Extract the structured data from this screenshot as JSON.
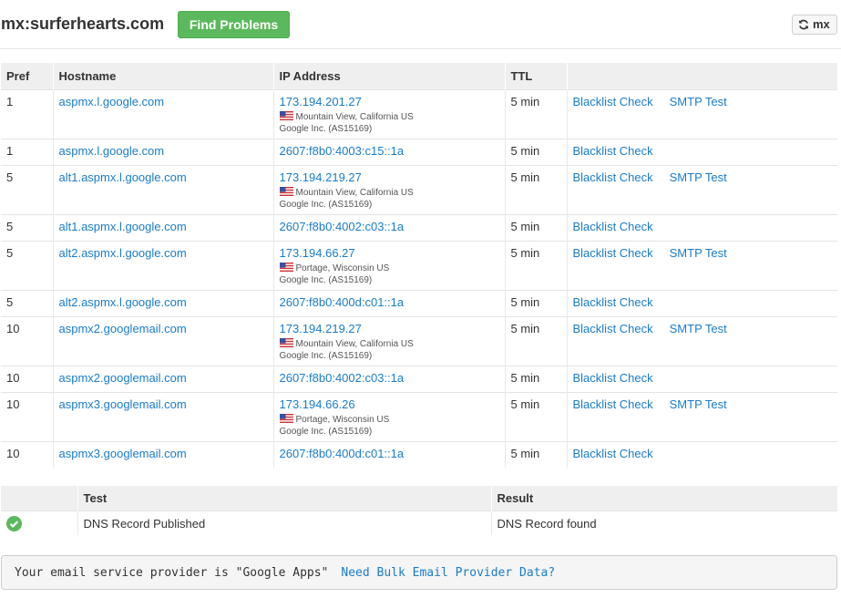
{
  "header": {
    "title": "mx:surferhearts.com",
    "find_button": "Find Problems",
    "mx_button": "mx"
  },
  "mx_table": {
    "columns": [
      "Pref",
      "Hostname",
      "IP Address",
      "TTL",
      ""
    ],
    "rows": [
      {
        "pref": "1",
        "hostname": "aspmx.l.google.com",
        "ip": "173.194.201.27",
        "location": "Mountain View, California US",
        "asn": "Google Inc. (AS15169)",
        "ttl": "5 min",
        "action1": "Blacklist Check",
        "action2": "SMTP Test"
      },
      {
        "pref": "1",
        "hostname": "aspmx.l.google.com",
        "ip": "2607:f8b0:4003:c15::1a",
        "location": "",
        "asn": "",
        "ttl": "5 min",
        "action1": "Blacklist Check",
        "action2": ""
      },
      {
        "pref": "5",
        "hostname": "alt1.aspmx.l.google.com",
        "ip": "173.194.219.27",
        "location": "Mountain View, California US",
        "asn": "Google Inc. (AS15169)",
        "ttl": "5 min",
        "action1": "Blacklist Check",
        "action2": "SMTP Test"
      },
      {
        "pref": "5",
        "hostname": "alt1.aspmx.l.google.com",
        "ip": "2607:f8b0:4002:c03::1a",
        "location": "",
        "asn": "",
        "ttl": "5 min",
        "action1": "Blacklist Check",
        "action2": ""
      },
      {
        "pref": "5",
        "hostname": "alt2.aspmx.l.google.com",
        "ip": "173.194.66.27",
        "location": "Portage, Wisconsin US",
        "asn": "Google Inc. (AS15169)",
        "ttl": "5 min",
        "action1": "Blacklist Check",
        "action2": "SMTP Test"
      },
      {
        "pref": "5",
        "hostname": "alt2.aspmx.l.google.com",
        "ip": "2607:f8b0:400d:c01::1a",
        "location": "",
        "asn": "",
        "ttl": "5 min",
        "action1": "Blacklist Check",
        "action2": ""
      },
      {
        "pref": "10",
        "hostname": "aspmx2.googlemail.com",
        "ip": "173.194.219.27",
        "location": "Mountain View, California US",
        "asn": "Google Inc. (AS15169)",
        "ttl": "5 min",
        "action1": "Blacklist Check",
        "action2": "SMTP Test"
      },
      {
        "pref": "10",
        "hostname": "aspmx2.googlemail.com",
        "ip": "2607:f8b0:4002:c03::1a",
        "location": "",
        "asn": "",
        "ttl": "5 min",
        "action1": "Blacklist Check",
        "action2": ""
      },
      {
        "pref": "10",
        "hostname": "aspmx3.googlemail.com",
        "ip": "173.194.66.26",
        "location": "Portage, Wisconsin US",
        "asn": "Google Inc. (AS15169)",
        "ttl": "5 min",
        "action1": "Blacklist Check",
        "action2": "SMTP Test"
      },
      {
        "pref": "10",
        "hostname": "aspmx3.googlemail.com",
        "ip": "2607:f8b0:400d:c01::1a",
        "location": "",
        "asn": "",
        "ttl": "5 min",
        "action1": "Blacklist Check",
        "action2": ""
      }
    ]
  },
  "test_table": {
    "columns": [
      "",
      "Test",
      "Result"
    ],
    "rows": [
      {
        "status_icon": "check-circle-icon",
        "test": "DNS Record Published",
        "result": "DNS Record found"
      }
    ]
  },
  "provider": {
    "text": "Your email service provider is \"Google Apps\"",
    "link": "Need Bulk Email Provider Data?"
  },
  "colors": {
    "link": "#1a7cc9",
    "button_green": "#5cb85c",
    "header_bg": "#efefef"
  }
}
